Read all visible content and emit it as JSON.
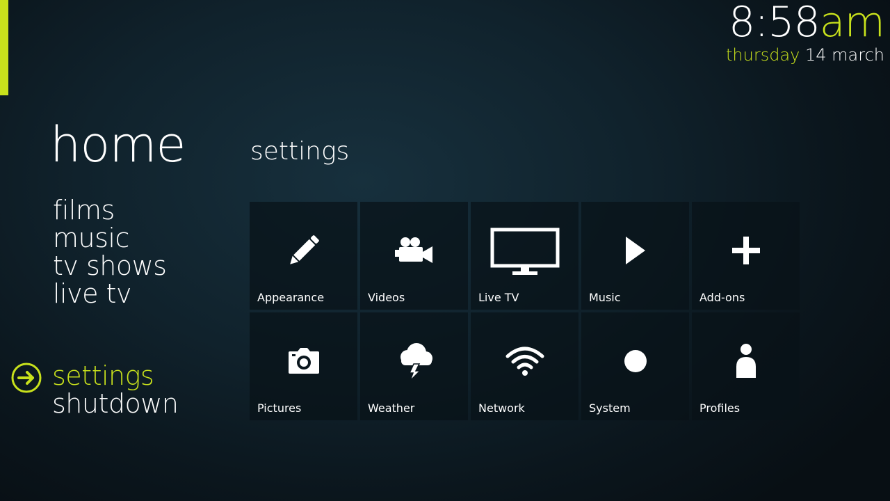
{
  "colors": {
    "accent": "#c8e11c",
    "text": "#ffffff",
    "tile_bg": "#0a161d"
  },
  "clock": {
    "time": "8:58",
    "ampm": "am",
    "weekday": "thursday",
    "date": "14 march"
  },
  "home_title": "home",
  "menu": {
    "items": [
      {
        "label": "films"
      },
      {
        "label": "music"
      },
      {
        "label": "tv shows"
      },
      {
        "label": "live tv"
      }
    ],
    "bottom_items": [
      {
        "label": "settings",
        "active": true,
        "icon": "arrow-right-circle-icon"
      },
      {
        "label": "shutdown",
        "active": false
      }
    ]
  },
  "section_title": "settings",
  "tiles": [
    {
      "label": "Appearance",
      "icon": "pencil-icon"
    },
    {
      "label": "Videos",
      "icon": "movie-camera-icon"
    },
    {
      "label": "Live TV",
      "icon": "tv-icon"
    },
    {
      "label": "Music",
      "icon": "play-icon"
    },
    {
      "label": "Add-ons",
      "icon": "plus-icon"
    },
    {
      "label": "Pictures",
      "icon": "camera-icon"
    },
    {
      "label": "Weather",
      "icon": "storm-cloud-icon"
    },
    {
      "label": "Network",
      "icon": "wifi-icon"
    },
    {
      "label": "System",
      "icon": "circle-icon"
    },
    {
      "label": "Profiles",
      "icon": "person-icon"
    }
  ]
}
